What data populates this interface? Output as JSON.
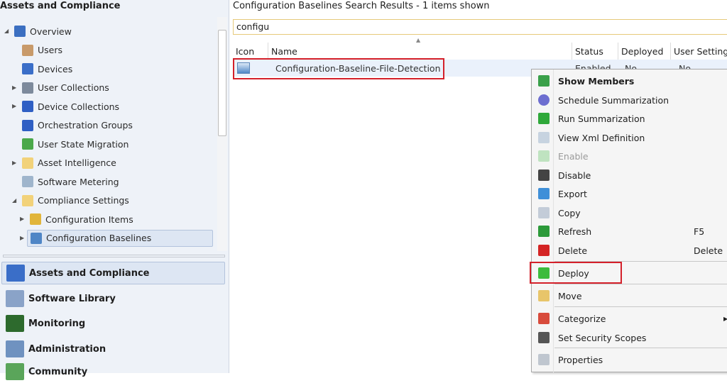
{
  "left_pane": {
    "title": "Assets and Compliance",
    "tree": [
      {
        "label": "Overview",
        "icon": "overview-icon",
        "expanded": true
      },
      {
        "label": "Users",
        "icon": "users-icon"
      },
      {
        "label": "Devices",
        "icon": "devices-icon"
      },
      {
        "label": "User Collections",
        "icon": "user-collections-icon",
        "expander": true
      },
      {
        "label": "Device Collections",
        "icon": "device-collections-icon",
        "expander": true
      },
      {
        "label": "Orchestration Groups",
        "icon": "orchestration-groups-icon"
      },
      {
        "label": "User State Migration",
        "icon": "user-state-migration-icon"
      },
      {
        "label": "Asset Intelligence",
        "icon": "folder-icon",
        "expander": true
      },
      {
        "label": "Software Metering",
        "icon": "software-metering-icon"
      },
      {
        "label": "Compliance Settings",
        "icon": "folder-icon",
        "expanded": true
      },
      {
        "label": "Configuration Items",
        "icon": "configuration-items-icon",
        "expander": true
      },
      {
        "label": "Configuration Baselines",
        "icon": "configuration-baselines-icon",
        "expander": true,
        "selected": true
      }
    ],
    "nav": [
      {
        "label": "Assets and Compliance",
        "icon": "assets-compliance-icon",
        "selected": true
      },
      {
        "label": "Software Library",
        "icon": "software-library-icon"
      },
      {
        "label": "Monitoring",
        "icon": "monitoring-icon"
      },
      {
        "label": "Administration",
        "icon": "administration-icon"
      },
      {
        "label": "Community",
        "icon": "community-icon"
      }
    ]
  },
  "results": {
    "title": "Configuration Baselines Search Results  -  1 items shown",
    "search_value": "configu",
    "columns": [
      "Icon",
      "Name",
      "Status",
      "Deployed",
      "User Setting"
    ],
    "rows": [
      {
        "name": "Configuration-Baseline-File-Detection",
        "status": "Enabled",
        "deployed": "No",
        "user_setting": "No"
      }
    ]
  },
  "context_menu": {
    "items": [
      {
        "label": "Show Members",
        "icon": "show-members-icon",
        "bold": true
      },
      {
        "label": "Schedule Summarization",
        "icon": "clock-icon"
      },
      {
        "label": "Run Summarization",
        "icon": "play-icon"
      },
      {
        "label": "View Xml Definition",
        "icon": "xml-document-icon"
      },
      {
        "label": "Enable",
        "icon": "up-arrow-icon",
        "disabled": true
      },
      {
        "label": "Disable",
        "icon": "down-arrow-icon"
      },
      {
        "label": "Export",
        "icon": "export-icon"
      },
      {
        "label": "Copy",
        "icon": "copy-icon"
      },
      {
        "label": "Refresh",
        "icon": "refresh-icon",
        "shortcut": "F5"
      },
      {
        "label": "Delete",
        "icon": "delete-icon",
        "shortcut": "Delete"
      },
      {
        "label": "Deploy",
        "icon": "deploy-arrow-icon",
        "highlighted": true
      },
      {
        "label": "Move",
        "icon": "move-folder-icon"
      },
      {
        "label": "Categorize",
        "icon": "categorize-icon",
        "submenu": true
      },
      {
        "label": "Set Security Scopes",
        "icon": "lock-icon"
      },
      {
        "label": "Properties",
        "icon": "properties-icon"
      }
    ]
  },
  "colors": {
    "highlight_box": "#d4202a",
    "pane_bg": "#eef2f8"
  }
}
